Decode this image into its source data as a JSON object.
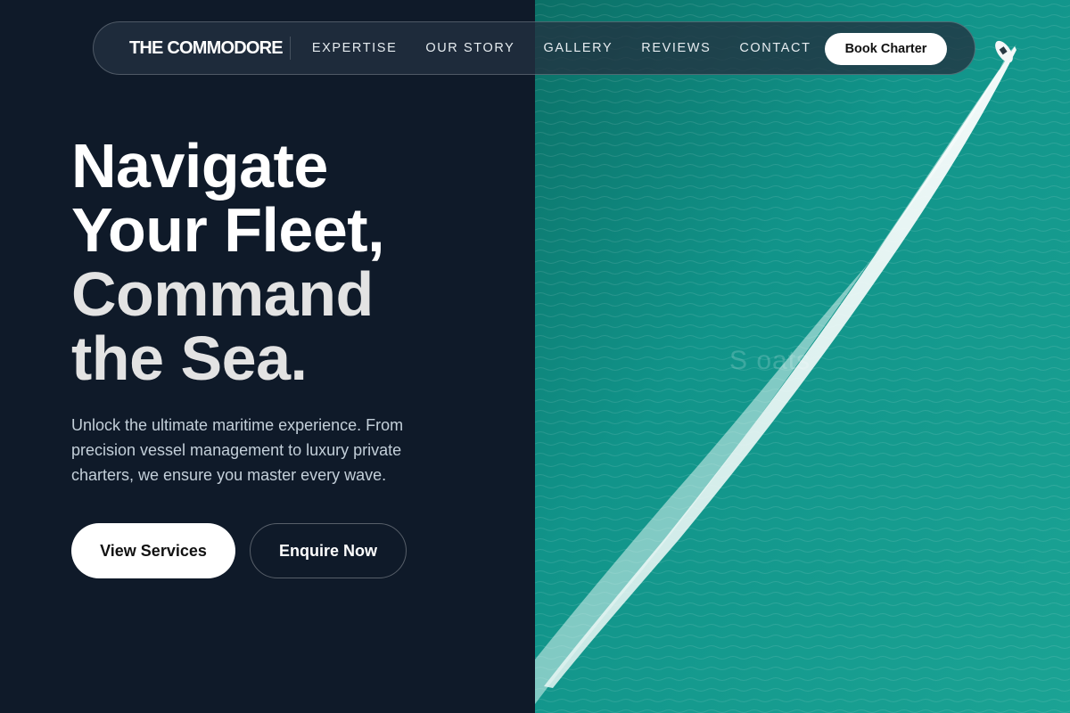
{
  "nav": {
    "logo": "THE COMMODORE",
    "links": [
      "EXPERTISE",
      "OUR STORY",
      "GALLERY",
      "REVIEWS",
      "CONTACT"
    ],
    "cta": "Book Charter"
  },
  "hero": {
    "title_lines": [
      "Navigate",
      "Your Fleet,",
      "Command",
      "the Sea."
    ],
    "subtitle": "Unlock the ultimate maritime experience. From precision vessel management to luxury private charters, we ensure you master every wave.",
    "primary_button": "View Services",
    "secondary_button": "Enquire Now",
    "image_watermark": "S     oats"
  },
  "colors": {
    "background": "#0f1a29",
    "sea": "#12968a",
    "text_primary": "#ffffff",
    "text_secondary": "#c3cfd9"
  }
}
